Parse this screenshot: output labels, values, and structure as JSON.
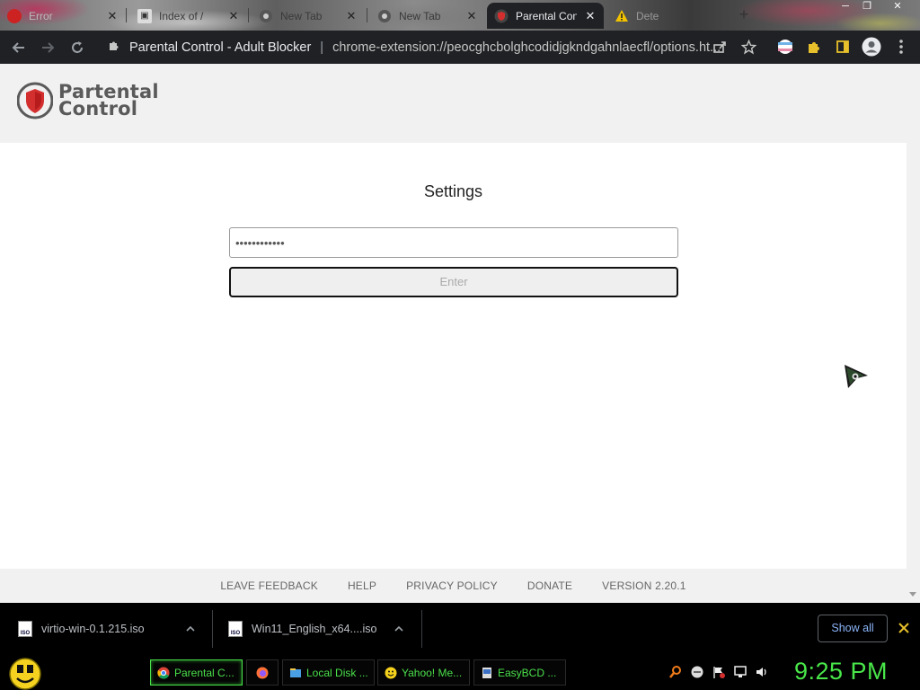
{
  "browser": {
    "tabs": [
      {
        "label": "Error",
        "icon": "tab-page-icon",
        "active": false
      },
      {
        "label": "Index of /",
        "icon": "server-icon",
        "active": false
      },
      {
        "label": "New Tab",
        "icon": "chrome-icon",
        "active": false
      },
      {
        "label": "New Tab",
        "icon": "chrome-icon",
        "active": false
      },
      {
        "label": "Parental Con",
        "icon": "shield-icon",
        "active": true
      },
      {
        "label": "Dete",
        "icon": "warning-icon",
        "active": false
      }
    ],
    "omnibox": {
      "site_name": "Parental Control - Adult Blocker",
      "separator": "|",
      "url": "chrome-extension://peocghcbolghcodidjgkndgahnlaecfl/options.ht..."
    }
  },
  "page": {
    "logo": {
      "line1": "Partental",
      "line2": "Control"
    },
    "title": "Settings",
    "password_value": "••••••••••••",
    "enter_label": "Enter",
    "footer": {
      "leave_feedback": "LEAVE FEEDBACK",
      "help": "HELP",
      "privacy_policy": "PRIVACY POLICY",
      "donate": "DONATE",
      "version": "VERSION 2.20.1"
    }
  },
  "downloads": {
    "items": [
      {
        "filename": "virtio-win-0.1.215.iso",
        "icon_text": "ISO"
      },
      {
        "filename": "Win11_English_x64....iso",
        "icon_text": "ISO"
      }
    ],
    "show_all_label": "Show all"
  },
  "taskbar": {
    "tasks": [
      {
        "label": "Parental C...",
        "icon": "chrome-icon",
        "active": true
      },
      {
        "label": "",
        "icon": "firefox-icon",
        "active": false
      },
      {
        "label": "Local Disk ...",
        "icon": "folder-icon",
        "active": false
      },
      {
        "label": "Yahoo! Me...",
        "icon": "yahoo-messenger-icon",
        "active": false
      },
      {
        "label": "EasyBCD ...",
        "icon": "easybcd-icon",
        "active": false
      }
    ],
    "clock": "9:25 PM"
  },
  "colors": {
    "accent_green": "#4ae04a",
    "shield_red": "#d32f2f",
    "chrome_dark": "#202124",
    "link_blue": "#8ab4f8"
  }
}
